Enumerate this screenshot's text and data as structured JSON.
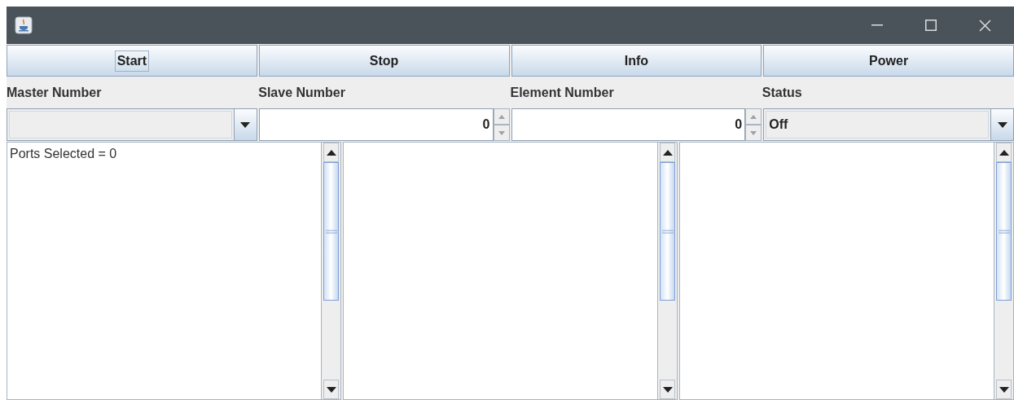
{
  "buttons": [
    {
      "label": "Start",
      "focused": true
    },
    {
      "label": "Stop",
      "focused": false
    },
    {
      "label": "Info",
      "focused": false
    },
    {
      "label": "Power",
      "focused": false
    }
  ],
  "fields": [
    {
      "label": "Master Number",
      "kind": "combo"
    },
    {
      "label": "Slave Number",
      "kind": "spinner",
      "value": "0"
    },
    {
      "label": "Element Number",
      "kind": "spinner",
      "value": "0"
    },
    {
      "label": "Status",
      "kind": "combo",
      "value": "Off"
    }
  ],
  "panes": [
    {
      "kind": "text_area",
      "text": "Ports Selected = 0"
    },
    {
      "kind": "text_area"
    },
    {
      "kind": "text_area"
    }
  ]
}
